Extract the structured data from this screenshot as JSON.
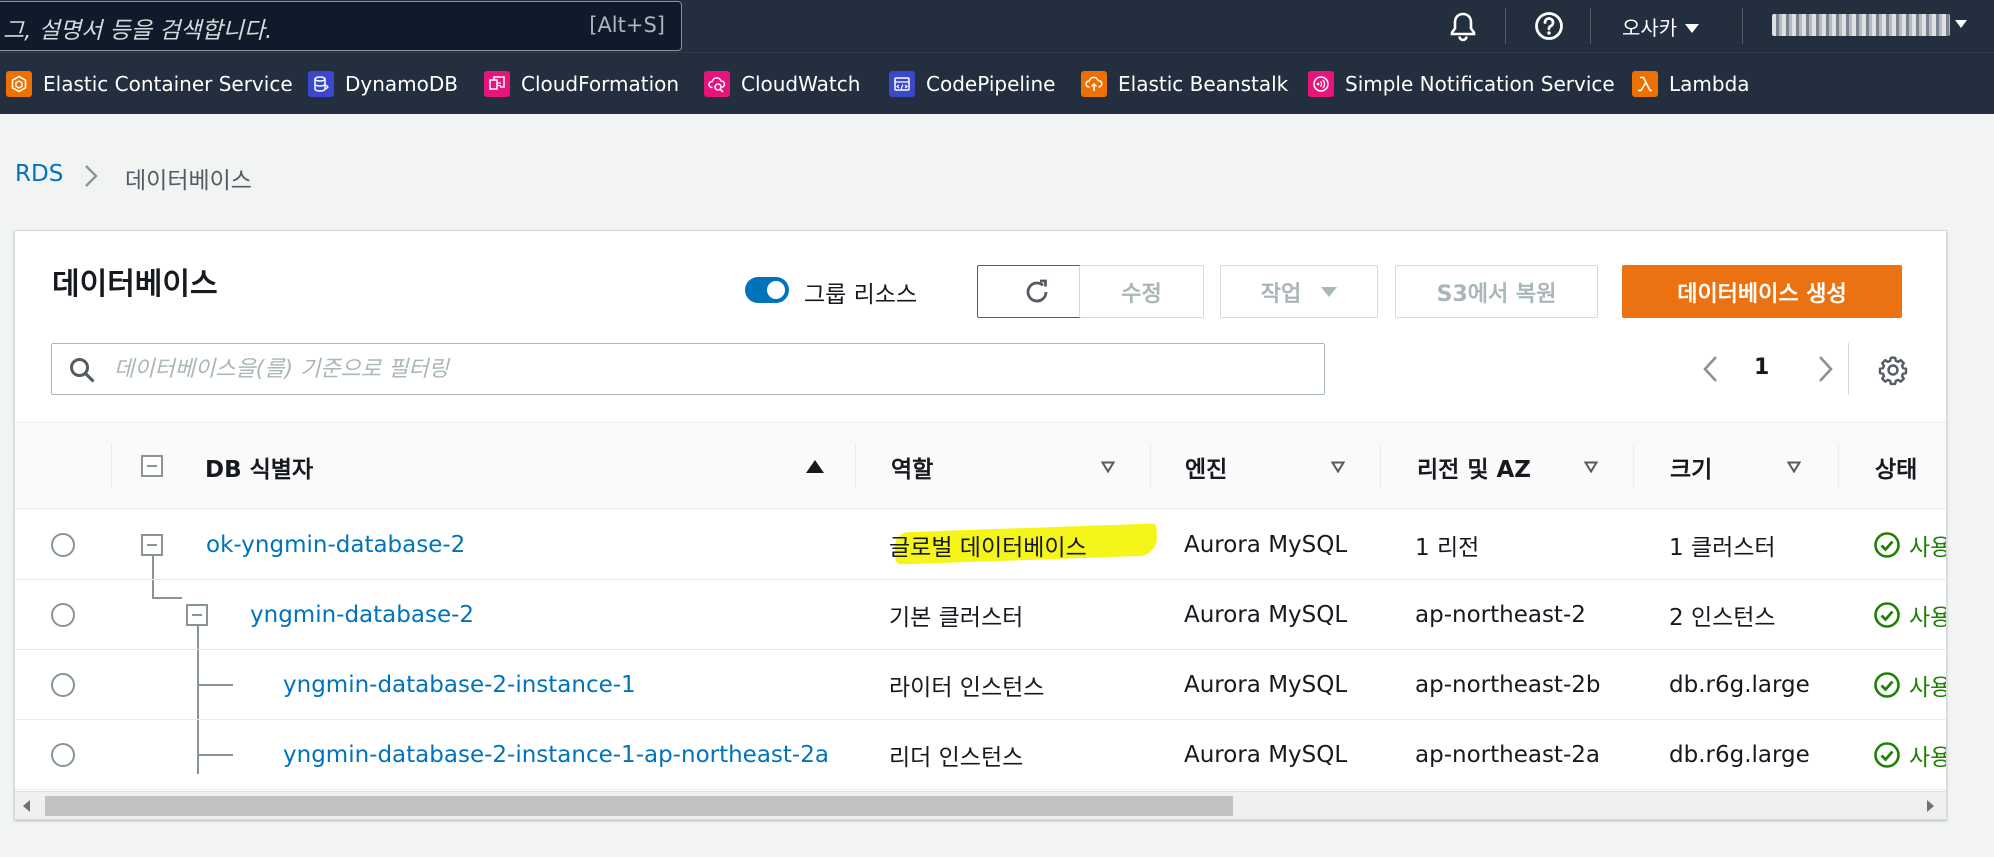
{
  "topbar": {
    "search_placeholder": "그, 설명서 등을 검색합니다.",
    "search_shortcut": "[Alt+S]",
    "region": "오사카",
    "icons": [
      "bell-icon",
      "help-icon"
    ]
  },
  "favorites": [
    {
      "label": "Elastic Container Service",
      "color": "#ed7100"
    },
    {
      "label": "DynamoDB",
      "color": "#3b48cc"
    },
    {
      "label": "CloudFormation",
      "color": "#e7157b"
    },
    {
      "label": "CloudWatch",
      "color": "#e7157b"
    },
    {
      "label": "CodePipeline",
      "color": "#3b48cc"
    },
    {
      "label": "Elastic Beanstalk",
      "color": "#ed7100"
    },
    {
      "label": "Simple Notification Service",
      "color": "#e7157b"
    },
    {
      "label": "Lambda",
      "color": "#ed7100"
    }
  ],
  "breadcrumb": {
    "root": "RDS",
    "current": "데이터베이스"
  },
  "panel": {
    "title": "데이터베이스",
    "group_toggle_label": "그룹 리소스",
    "buttons": {
      "modify": "수정",
      "actions": "작업",
      "restore_s3": "S3에서 복원",
      "create": "데이터베이스 생성"
    },
    "filter_placeholder": "데이터베이스을(를) 기준으로 필터링",
    "page": "1"
  },
  "table": {
    "columns": [
      "DB 식별자",
      "역할",
      "엔진",
      "리전 및 AZ",
      "크기",
      "상태"
    ],
    "rows": [
      {
        "id": "ok-yngmin-database-2",
        "role": "글로벌 데이터베이스",
        "engine": "Aurora MySQL",
        "region": "1 리전",
        "size": "1 클러스터",
        "status": "사용"
      },
      {
        "id": "yngmin-database-2",
        "role": "기본 클러스터",
        "engine": "Aurora MySQL",
        "region": "ap-northeast-2",
        "size": "2 인스턴스",
        "status": "사용"
      },
      {
        "id": "yngmin-database-2-instance-1",
        "role": "라이터 인스턴스",
        "engine": "Aurora MySQL",
        "region": "ap-northeast-2b",
        "size": "db.r6g.large",
        "status": "사용"
      },
      {
        "id": "yngmin-database-2-instance-1-ap-northeast-2a",
        "role": "리더 인스턴스",
        "engine": "Aurora MySQL",
        "region": "ap-northeast-2a",
        "size": "db.r6g.large",
        "status": "사용"
      }
    ]
  },
  "colors": {
    "nav_bg": "#232f3e",
    "link": "#0073bb",
    "primary": "#ec7211",
    "success": "#1d8102",
    "highlight": "#f5f51a"
  }
}
